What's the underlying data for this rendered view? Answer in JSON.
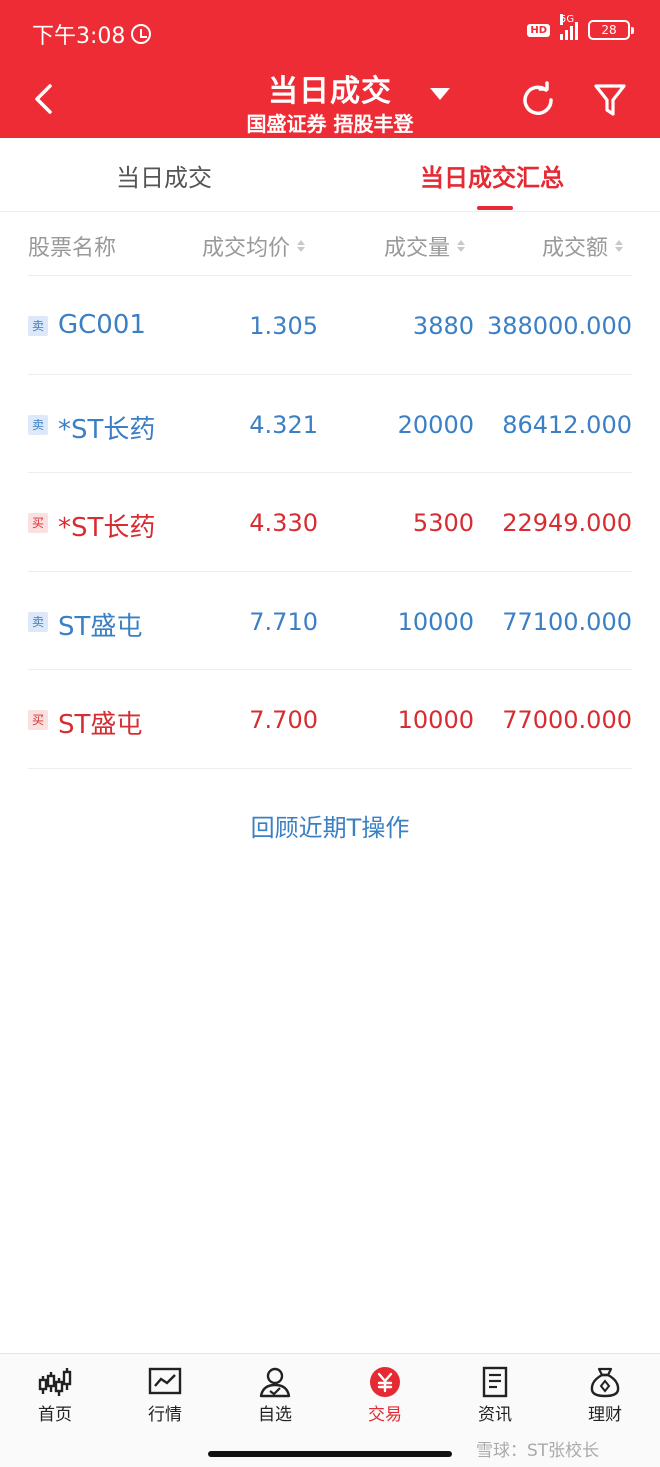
{
  "status_bar": {
    "time": "下午3:08",
    "hd": "HD",
    "network": "5G",
    "battery": "28"
  },
  "header": {
    "title": "当日成交",
    "subtitle": "国盛证券 捂股丰登"
  },
  "tabs": [
    {
      "label": "当日成交",
      "active": false
    },
    {
      "label": "当日成交汇总",
      "active": true
    }
  ],
  "table": {
    "columns": [
      "股票名称",
      "成交均价",
      "成交量",
      "成交额"
    ],
    "rows": [
      {
        "side": "卖",
        "name": "GC001",
        "price": "1.305",
        "volume": "3880",
        "amount": "388000.000"
      },
      {
        "side": "卖",
        "name": "*ST长药",
        "price": "4.321",
        "volume": "20000",
        "amount": "86412.000"
      },
      {
        "side": "买",
        "name": "*ST长药",
        "price": "4.330",
        "volume": "5300",
        "amount": "22949.000"
      },
      {
        "side": "卖",
        "name": "ST盛屯",
        "price": "7.710",
        "volume": "10000",
        "amount": "77100.000"
      },
      {
        "side": "买",
        "name": "ST盛屯",
        "price": "7.700",
        "volume": "10000",
        "amount": "77000.000"
      }
    ]
  },
  "review_link": "回顾近期T操作",
  "bottom_nav": [
    {
      "label": "首页",
      "icon": "candlestick-icon"
    },
    {
      "label": "行情",
      "icon": "chart-icon"
    },
    {
      "label": "自选",
      "icon": "user-check-icon"
    },
    {
      "label": "交易",
      "icon": "yuan-icon",
      "active": true
    },
    {
      "label": "资讯",
      "icon": "document-icon"
    },
    {
      "label": "理财",
      "icon": "money-bag-icon"
    }
  ],
  "watermark": "雪球：ST张校长",
  "colors": {
    "brand_red": "#ee2c36",
    "sell_blue": "#3b7fc4",
    "buy_red": "#d62d32"
  }
}
